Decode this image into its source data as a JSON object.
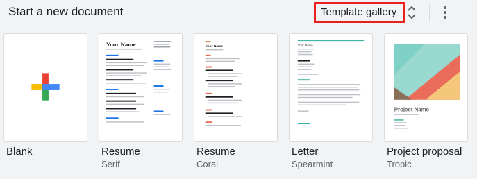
{
  "header": {
    "title": "Start a new document",
    "gallery_label": "Template gallery",
    "expand_icon": "unfold-more-icon",
    "more_icon": "more-vert-icon"
  },
  "templates": [
    {
      "title": "Blank",
      "subtitle": "",
      "icon": "plus-icon"
    },
    {
      "title": "Resume",
      "subtitle": "Serif",
      "preview_heading": "Your Name"
    },
    {
      "title": "Resume",
      "subtitle": "Coral",
      "preview_heading": "Your Name"
    },
    {
      "title": "Letter",
      "subtitle": "Spearmint",
      "preview_heading": "Your Name"
    },
    {
      "title": "Project proposal",
      "subtitle": "Tropic",
      "preview_heading": "Project Name"
    }
  ],
  "colors": {
    "accent_highlight": "#e8211c",
    "plus_blue": "#4285f4",
    "plus_red": "#ea4335",
    "plus_yellow": "#fbbc04",
    "plus_green": "#34a853",
    "coral": "#e96d5a",
    "spearmint": "#42b3a0",
    "tropic_teal": "#7fd0c7"
  }
}
